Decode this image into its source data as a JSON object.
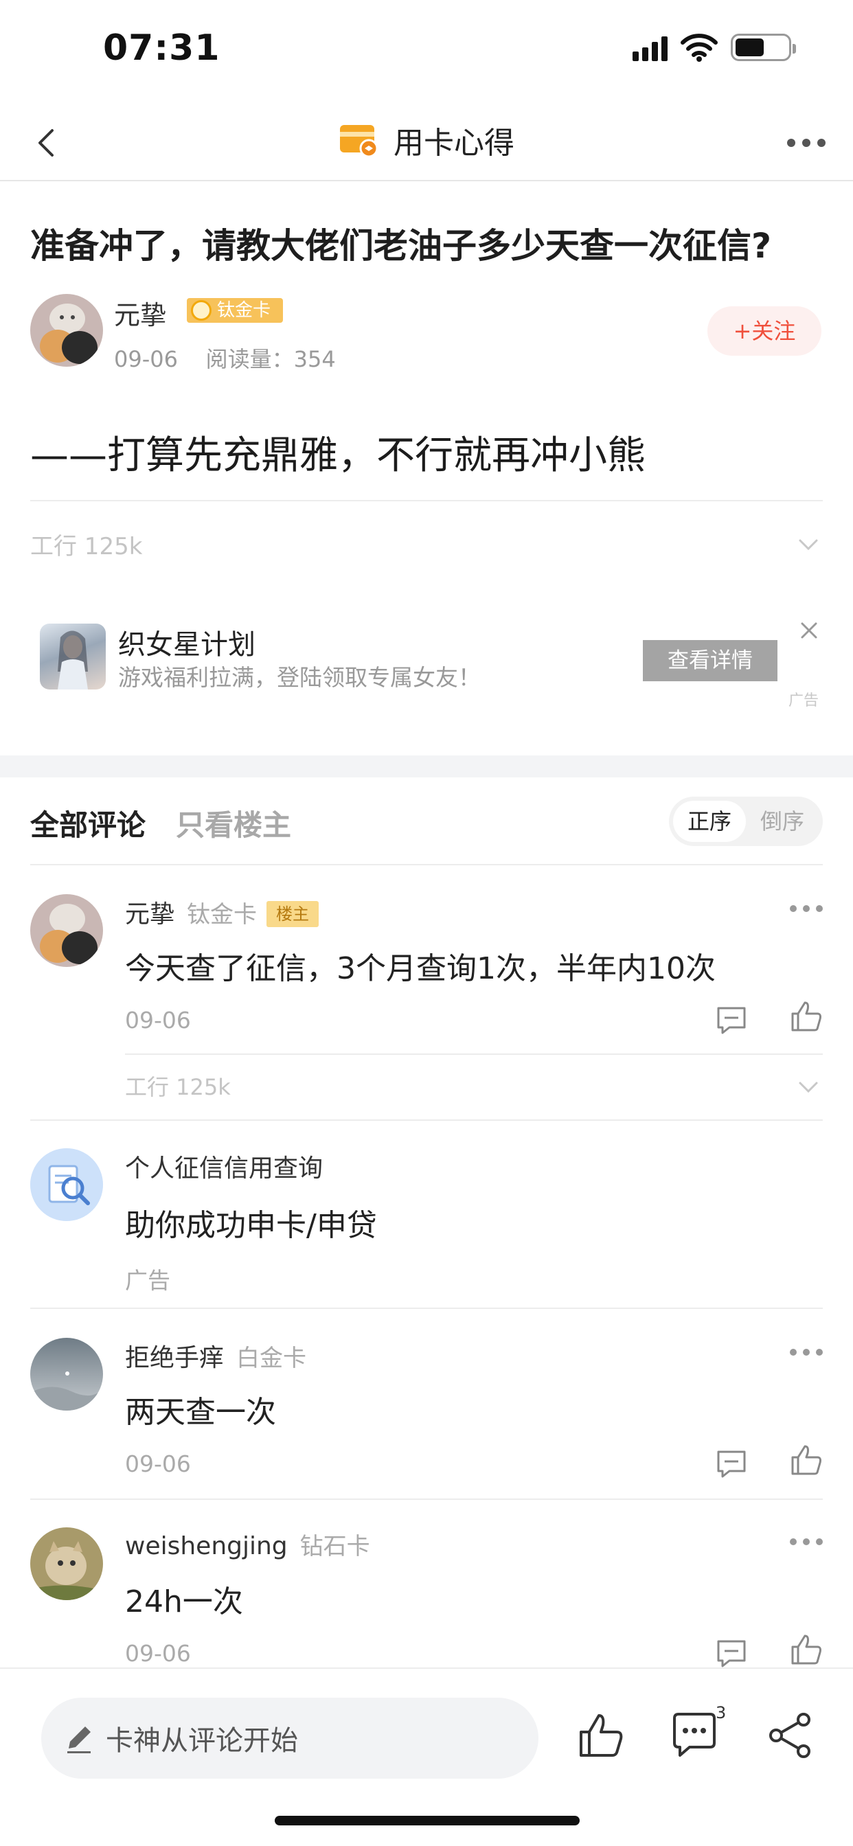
{
  "status_bar": {
    "time": "07:31"
  },
  "nav": {
    "title": "用卡心得"
  },
  "post": {
    "title": "准备冲了，请教大佬们老油子多少天查一次征信?",
    "author": {
      "name": "元挚",
      "badge": "钛金卡"
    },
    "date": "09-06",
    "reads": "阅读量：354",
    "follow_label": "+关注",
    "body": "——打算先充鼎雅，不行就再冲小熊",
    "tag": "工行 125k"
  },
  "ad": {
    "title": "织女星计划",
    "subtitle": "游戏福利拉满，登陆领取专属女友！",
    "button": "查看详情",
    "mark": "广告"
  },
  "comments_header": {
    "tab_all": "全部评论",
    "tab_owner": "只看楼主",
    "sort_asc": "正序",
    "sort_desc": "倒序"
  },
  "comments": [
    {
      "name": "元挚",
      "level": "钛金卡",
      "owner_tag": "楼主",
      "text": "今天查了征信，3个月查询1次，半年内10次",
      "date": "09-06",
      "tag": "工行 125k"
    },
    {
      "name": "拒绝手痒",
      "level": "白金卡",
      "text": "两天查一次",
      "date": "09-06"
    },
    {
      "name": "weishengjing",
      "level": "钻石卡",
      "text": "24h一次",
      "date": "09-06"
    }
  ],
  "comment_ad": {
    "title": "个人征信信用查询",
    "text": "助你成功申卡/申贷",
    "mark": "广告"
  },
  "bottom_bar": {
    "input_placeholder": "卡神从评论开始",
    "comment_count": "3"
  },
  "colors": {
    "accent": "#f0503c",
    "badge": "#f7c25a",
    "nav_icon": "#f5a623"
  }
}
